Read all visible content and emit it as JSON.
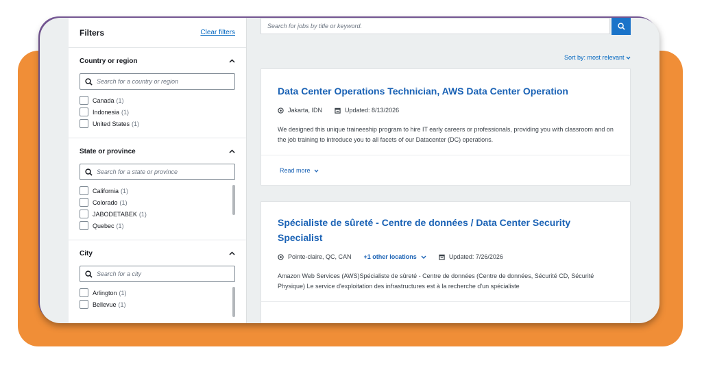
{
  "filters": {
    "title": "Filters",
    "clear_label": "Clear filters",
    "sections": [
      {
        "title": "Country or region",
        "placeholder": "Search for a country or region",
        "options": [
          {
            "label": "Canada",
            "count": "(1)"
          },
          {
            "label": "Indonesia",
            "count": "(1)"
          },
          {
            "label": "United States",
            "count": "(1)"
          }
        ]
      },
      {
        "title": "State or province",
        "placeholder": "Search for a state or province",
        "options": [
          {
            "label": "California",
            "count": "(1)"
          },
          {
            "label": "Colorado",
            "count": "(1)"
          },
          {
            "label": "JABODETABEK",
            "count": "(1)"
          },
          {
            "label": "Quebec",
            "count": "(1)"
          }
        ]
      },
      {
        "title": "City",
        "placeholder": "Search for a city",
        "options": [
          {
            "label": "Arlington",
            "count": "(1)"
          },
          {
            "label": "Bellevue",
            "count": "(1)"
          }
        ]
      }
    ]
  },
  "search": {
    "placeholder": "Search for jobs by title or keyword."
  },
  "sort": {
    "label": "Sort by: most relevant"
  },
  "jobs": [
    {
      "title": "Data Center Operations Technician, AWS Data Center Operation",
      "location": "Jakarta, IDN",
      "updated": "Updated: 8/13/2026",
      "description": "We designed this unique traineeship program to hire IT early careers or professionals, providing you with classroom and on the job training to introduce you to all facets of our Datacenter (DC) operations.",
      "read_more": "Read more"
    },
    {
      "title": "Spécialiste de sûreté - Centre de données / Data Center Security Specialist",
      "location": "Pointe-claire, QC, CAN",
      "other_locations": "+1 other locations",
      "updated": "Updated: 7/26/2026",
      "description": "Amazon Web Services (AWS)Spécialiste de sûreté - Centre de données (Centre de données, Sécurité CD, Sécurité Physique) Le service d'exploitation des infrastructures est à la recherche d'un spécialiste"
    }
  ],
  "colors": {
    "accent_orange": "#f08e37",
    "link_blue": "#1a62b5",
    "search_button": "#1a73c9"
  }
}
